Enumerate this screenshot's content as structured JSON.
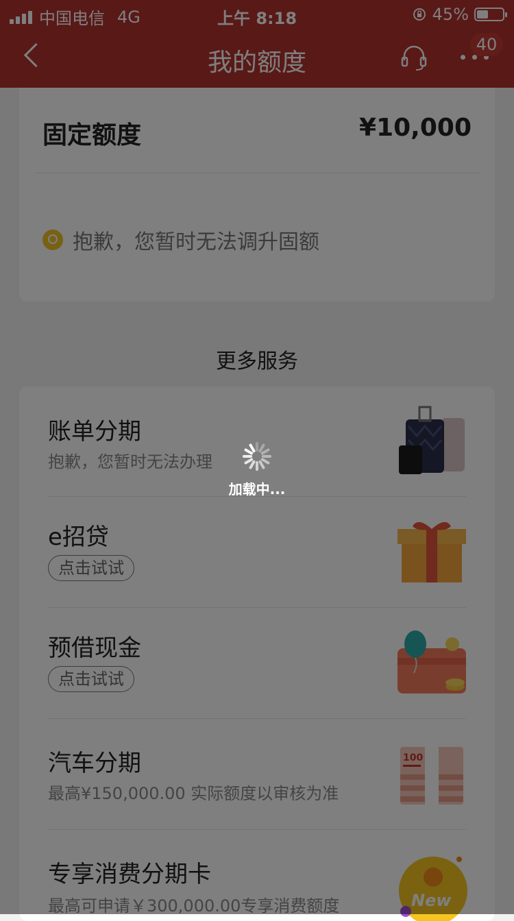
{
  "status_bar": {
    "carrier": "中国电信",
    "network": "4G",
    "time": "上午 8:18",
    "battery_text": "45%",
    "battery_level": 0.45
  },
  "nav": {
    "title": "我的额度",
    "badge": "40"
  },
  "quota": {
    "label": "固定额度",
    "amount": "¥10,000",
    "notice": "抱歉，您暂时无法调升固额"
  },
  "section_title": "更多服务",
  "services": [
    {
      "name": "账单分期",
      "subtitle": "抱歉，您暂时无法办理",
      "thumbnail": "luggage-image"
    },
    {
      "name": "e招贷",
      "button": "点击试试",
      "thumbnail": "gift-box-image"
    },
    {
      "name": "预借现金",
      "button": "点击试试",
      "thumbnail": "card-balloon-image"
    },
    {
      "name": "汽车分期",
      "subtitle": "最高¥150,000.00 实际额度以审核为准",
      "thumbnail": "cash-stack-image"
    },
    {
      "name": "专享消费分期卡",
      "subtitle": "最高可申请￥300,000.00专享消费额度",
      "thumbnail": "new-badge-image",
      "thumbnail_text": "New"
    }
  ],
  "loading": {
    "text": "加载中..."
  },
  "colors": {
    "brand": "#b3322e",
    "overlay": "rgba(0,0,0,0.5)"
  }
}
